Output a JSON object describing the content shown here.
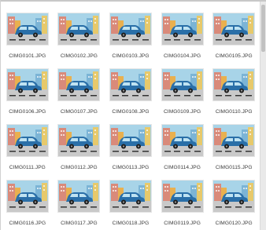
{
  "files": [
    {
      "name": "CIMG0101.JPG"
    },
    {
      "name": "CIMG0102.JPG"
    },
    {
      "name": "CIMG0103.JPG"
    },
    {
      "name": "CIMG0104.JPG"
    },
    {
      "name": "CIMG0105.JPG"
    },
    {
      "name": "CIMG0106.JPG"
    },
    {
      "name": "CIMG0107.JPG"
    },
    {
      "name": "CIMG0108.JPG"
    },
    {
      "name": "CIMG0109.JPG"
    },
    {
      "name": "CIMG0110.JPG"
    },
    {
      "name": "CIMG0111.JPG"
    },
    {
      "name": "CIMG0112.JPG"
    },
    {
      "name": "CIMG0113.JPG"
    },
    {
      "name": "CIMG0114.JPG"
    },
    {
      "name": "CIMG0115.JPG"
    },
    {
      "name": "CIMG0116.JPG"
    },
    {
      "name": "CIMG0117.JPG"
    },
    {
      "name": "CIMG0118.JPG"
    },
    {
      "name": "CIMG0119.JPG"
    },
    {
      "name": "CIMG0120.JPG"
    }
  ],
  "thumbnail": {
    "icon": "car-city-photo-icon",
    "colors": {
      "sky": "#a8d4e8",
      "building_left": "#d98a7a",
      "building_left2": "#e9b04f",
      "building_right": "#7bb4d6",
      "building_right2": "#e7c96b",
      "road": "#c9c9c9",
      "road_marks": "#333333",
      "car_body": "#2a6fa8",
      "car_window": "#bfe3f2",
      "wheel": "#1e1e1e"
    }
  }
}
